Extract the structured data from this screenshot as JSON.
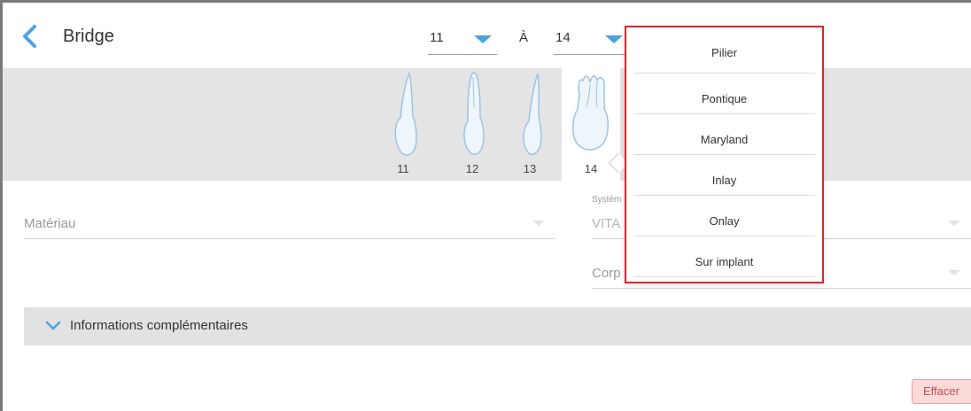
{
  "header": {
    "title": "Bridge",
    "from_value": "11",
    "to_label": "À",
    "to_value": "14"
  },
  "teeth": [
    {
      "number": "11",
      "selected": false
    },
    {
      "number": "12",
      "selected": false
    },
    {
      "number": "13",
      "selected": false
    },
    {
      "number": "14",
      "selected": true
    }
  ],
  "form": {
    "material_label": "Matériau",
    "system_small_label": "Systèm",
    "system_value": "VITA",
    "corps_label": "Corp"
  },
  "info_bar": {
    "label": "Informations complémentaires"
  },
  "clear_button": "Effacer",
  "dropdown": {
    "items": [
      "Pilier",
      "Pontique",
      "Maryland",
      "Inlay",
      "Onlay",
      "Sur implant"
    ]
  },
  "colors": {
    "accent": "#4aa3df",
    "highlight_border": "#d9262c",
    "clear_bg": "#fbdada",
    "clear_text": "#c0504d"
  },
  "icons": {
    "back": "chevron-left-icon",
    "caret": "caret-down-icon",
    "expand": "chevron-down-icon",
    "tooth": "tooth-icon"
  }
}
